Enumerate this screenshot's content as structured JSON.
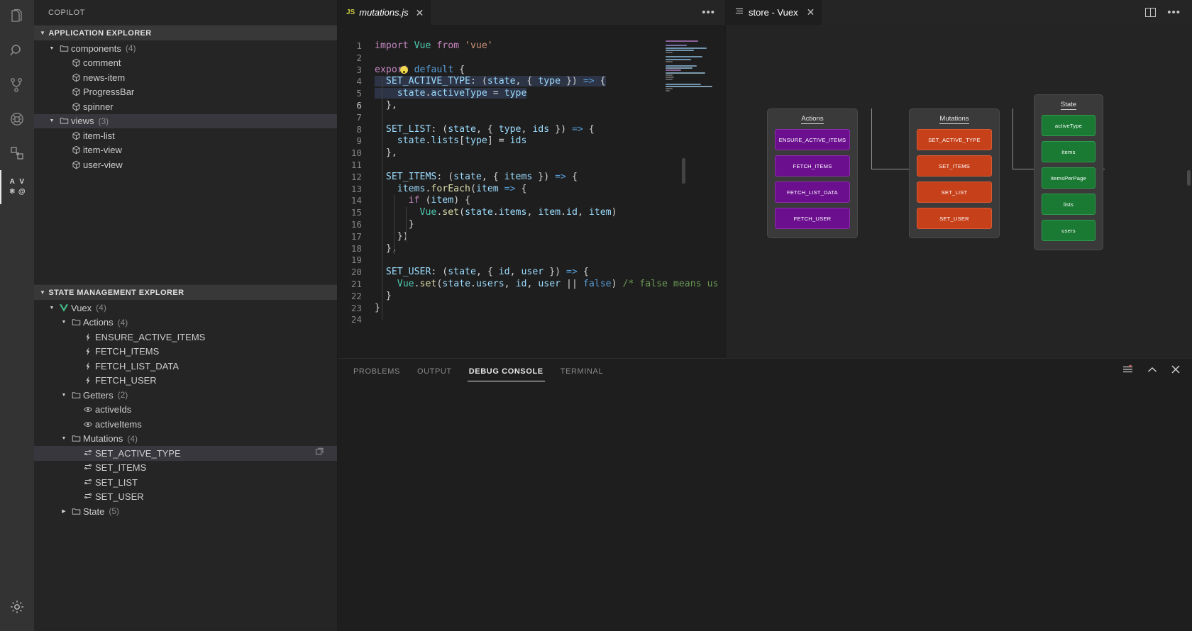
{
  "activity_bar": {
    "items": [
      {
        "name": "explorer-icon",
        "title": "Explorer",
        "active": false
      },
      {
        "name": "search-icon",
        "title": "Search",
        "active": false
      },
      {
        "name": "source-control-icon",
        "title": "Source Control",
        "active": false
      },
      {
        "name": "run-and-debug-icon",
        "title": "Run and Debug",
        "active": false
      },
      {
        "name": "extensions-icon",
        "title": "Extensions",
        "active": false
      },
      {
        "name": "state-explorer-icon",
        "title": "State Explorer",
        "active": true
      }
    ],
    "framework_glyphs": [
      "A",
      "V",
      "⚛",
      "@"
    ],
    "settings": {
      "name": "gear-icon",
      "title": "Manage"
    }
  },
  "sidebar": {
    "title": "COPILOT",
    "sections": [
      {
        "header": "APPLICATION EXPLORER",
        "items": [
          {
            "label": "components",
            "count": "(4)",
            "depth": 1,
            "icon": "folder-icon",
            "twisty": "open",
            "selected": false
          },
          {
            "label": "comment",
            "count": "",
            "depth": 2,
            "icon": "component-icon",
            "twisty": "none",
            "selected": false
          },
          {
            "label": "news-item",
            "count": "",
            "depth": 2,
            "icon": "component-icon",
            "twisty": "none",
            "selected": false
          },
          {
            "label": "ProgressBar",
            "count": "",
            "depth": 2,
            "icon": "component-icon",
            "twisty": "none",
            "selected": false
          },
          {
            "label": "spinner",
            "count": "",
            "depth": 2,
            "icon": "component-icon",
            "twisty": "none",
            "selected": false
          },
          {
            "label": "views",
            "count": "(3)",
            "depth": 1,
            "icon": "folder-icon",
            "twisty": "open",
            "selected": true
          },
          {
            "label": "item-list",
            "count": "",
            "depth": 2,
            "icon": "component-icon",
            "twisty": "none",
            "selected": false
          },
          {
            "label": "item-view",
            "count": "",
            "depth": 2,
            "icon": "component-icon",
            "twisty": "none",
            "selected": false
          },
          {
            "label": "user-view",
            "count": "",
            "depth": 2,
            "icon": "component-icon",
            "twisty": "none",
            "selected": false
          }
        ]
      },
      {
        "header": "STATE MANAGEMENT EXPLORER",
        "items": [
          {
            "label": "Vuex",
            "count": "(4)",
            "depth": 1,
            "icon": "vue-icon",
            "twisty": "open",
            "selected": false
          },
          {
            "label": "Actions",
            "count": "(4)",
            "depth": 2,
            "icon": "folder-icon",
            "twisty": "open",
            "selected": false
          },
          {
            "label": "ENSURE_ACTIVE_ITEMS",
            "count": "",
            "depth": 3,
            "icon": "action-icon",
            "twisty": "none",
            "selected": false
          },
          {
            "label": "FETCH_ITEMS",
            "count": "",
            "depth": 3,
            "icon": "action-icon",
            "twisty": "none",
            "selected": false
          },
          {
            "label": "FETCH_LIST_DATA",
            "count": "",
            "depth": 3,
            "icon": "action-icon",
            "twisty": "none",
            "selected": false
          },
          {
            "label": "FETCH_USER",
            "count": "",
            "depth": 3,
            "icon": "action-icon",
            "twisty": "none",
            "selected": false
          },
          {
            "label": "Getters",
            "count": "(2)",
            "depth": 2,
            "icon": "folder-icon",
            "twisty": "open",
            "selected": false
          },
          {
            "label": "activeIds",
            "count": "",
            "depth": 3,
            "icon": "getter-eye-icon",
            "twisty": "none",
            "selected": false
          },
          {
            "label": "activeItems",
            "count": "",
            "depth": 3,
            "icon": "getter-eye-icon",
            "twisty": "none",
            "selected": false
          },
          {
            "label": "Mutations",
            "count": "(4)",
            "depth": 2,
            "icon": "folder-icon",
            "twisty": "open",
            "selected": false
          },
          {
            "label": "SET_ACTIVE_TYPE",
            "count": "",
            "depth": 3,
            "icon": "mutation-icon",
            "twisty": "none",
            "selected": true,
            "action": "open-preview-icon"
          },
          {
            "label": "SET_ITEMS",
            "count": "",
            "depth": 3,
            "icon": "mutation-icon",
            "twisty": "none",
            "selected": false
          },
          {
            "label": "SET_LIST",
            "count": "",
            "depth": 3,
            "icon": "mutation-icon",
            "twisty": "none",
            "selected": false
          },
          {
            "label": "SET_USER",
            "count": "",
            "depth": 3,
            "icon": "mutation-icon",
            "twisty": "none",
            "selected": false
          },
          {
            "label": "State",
            "count": "(5)",
            "depth": 2,
            "icon": "folder-icon",
            "twisty": "closed",
            "selected": false
          }
        ]
      }
    ]
  },
  "editor": {
    "tab": {
      "badge": "JS",
      "filename": "mutations.js",
      "close": "✕"
    },
    "more_actions": "•••",
    "lines": [
      {
        "n": "1",
        "tokens": [
          {
            "t": "import ",
            "c": "kw"
          },
          {
            "t": "Vue",
            "c": "cls"
          },
          {
            "t": " from ",
            "c": "kw"
          },
          {
            "t": "'vue'",
            "c": "str"
          }
        ]
      },
      {
        "n": "2",
        "tokens": []
      },
      {
        "n": "3",
        "tokens": [
          {
            "t": "export ",
            "c": "kw"
          },
          {
            "t": "default",
            "c": "kw2"
          },
          {
            "t": " {",
            "c": "pl"
          }
        ]
      },
      {
        "n": "4",
        "tokens": [
          {
            "t": "  SET_ACTIVE_TYPE",
            "c": "var"
          },
          {
            "t": ": (",
            "c": "pl"
          },
          {
            "t": "state",
            "c": "var"
          },
          {
            "t": ", { ",
            "c": "pl"
          },
          {
            "t": "type",
            "c": "var"
          },
          {
            "t": " }) ",
            "c": "pl"
          },
          {
            "t": "=>",
            "c": "arrow"
          },
          {
            "t": " {",
            "c": "pl"
          }
        ]
      },
      {
        "n": "5",
        "tokens": [
          {
            "t": "    state",
            "c": "var"
          },
          {
            "t": ".",
            "c": "pl"
          },
          {
            "t": "activeType",
            "c": "var"
          },
          {
            "t": " = ",
            "c": "pl"
          },
          {
            "t": "type",
            "c": "var"
          }
        ]
      },
      {
        "n": "6",
        "tokens": [
          {
            "t": "  },",
            "c": "pl"
          }
        ]
      },
      {
        "n": "7",
        "tokens": []
      },
      {
        "n": "8",
        "tokens": [
          {
            "t": "  SET_LIST",
            "c": "var"
          },
          {
            "t": ": (",
            "c": "pl"
          },
          {
            "t": "state",
            "c": "var"
          },
          {
            "t": ", { ",
            "c": "pl"
          },
          {
            "t": "type",
            "c": "var"
          },
          {
            "t": ", ",
            "c": "pl"
          },
          {
            "t": "ids",
            "c": "var"
          },
          {
            "t": " }) ",
            "c": "pl"
          },
          {
            "t": "=>",
            "c": "arrow"
          },
          {
            "t": " {",
            "c": "pl"
          }
        ]
      },
      {
        "n": "9",
        "tokens": [
          {
            "t": "    state",
            "c": "var"
          },
          {
            "t": ".",
            "c": "pl"
          },
          {
            "t": "lists",
            "c": "var"
          },
          {
            "t": "[",
            "c": "pl"
          },
          {
            "t": "type",
            "c": "var"
          },
          {
            "t": "] = ",
            "c": "pl"
          },
          {
            "t": "ids",
            "c": "var"
          }
        ]
      },
      {
        "n": "10",
        "tokens": [
          {
            "t": "  },",
            "c": "pl"
          }
        ]
      },
      {
        "n": "11",
        "tokens": []
      },
      {
        "n": "12",
        "tokens": [
          {
            "t": "  SET_ITEMS",
            "c": "var"
          },
          {
            "t": ": (",
            "c": "pl"
          },
          {
            "t": "state",
            "c": "var"
          },
          {
            "t": ", { ",
            "c": "pl"
          },
          {
            "t": "items",
            "c": "var"
          },
          {
            "t": " }) ",
            "c": "pl"
          },
          {
            "t": "=>",
            "c": "arrow"
          },
          {
            "t": " {",
            "c": "pl"
          }
        ]
      },
      {
        "n": "13",
        "tokens": [
          {
            "t": "    items",
            "c": "var"
          },
          {
            "t": ".",
            "c": "pl"
          },
          {
            "t": "forEach",
            "c": "fn"
          },
          {
            "t": "(",
            "c": "pl"
          },
          {
            "t": "item",
            "c": "var"
          },
          {
            "t": " ",
            "c": "pl"
          },
          {
            "t": "=>",
            "c": "arrow"
          },
          {
            "t": " {",
            "c": "pl"
          }
        ]
      },
      {
        "n": "14",
        "tokens": [
          {
            "t": "      if",
            "c": "kw"
          },
          {
            "t": " (",
            "c": "pl"
          },
          {
            "t": "item",
            "c": "var"
          },
          {
            "t": ") {",
            "c": "pl"
          }
        ]
      },
      {
        "n": "15",
        "tokens": [
          {
            "t": "        Vue",
            "c": "cls"
          },
          {
            "t": ".",
            "c": "pl"
          },
          {
            "t": "set",
            "c": "fn"
          },
          {
            "t": "(",
            "c": "pl"
          },
          {
            "t": "state",
            "c": "var"
          },
          {
            "t": ".",
            "c": "pl"
          },
          {
            "t": "items",
            "c": "var"
          },
          {
            "t": ", ",
            "c": "pl"
          },
          {
            "t": "item",
            "c": "var"
          },
          {
            "t": ".",
            "c": "pl"
          },
          {
            "t": "id",
            "c": "var"
          },
          {
            "t": ", ",
            "c": "pl"
          },
          {
            "t": "item",
            "c": "var"
          },
          {
            "t": ")",
            "c": "pl"
          }
        ]
      },
      {
        "n": "16",
        "tokens": [
          {
            "t": "      }",
            "c": "pl"
          }
        ]
      },
      {
        "n": "17",
        "tokens": [
          {
            "t": "    })",
            "c": "pl"
          }
        ]
      },
      {
        "n": "18",
        "tokens": [
          {
            "t": "  },",
            "c": "pl"
          }
        ]
      },
      {
        "n": "19",
        "tokens": []
      },
      {
        "n": "20",
        "tokens": [
          {
            "t": "  SET_USER",
            "c": "var"
          },
          {
            "t": ": (",
            "c": "pl"
          },
          {
            "t": "state",
            "c": "var"
          },
          {
            "t": ", { ",
            "c": "pl"
          },
          {
            "t": "id",
            "c": "var"
          },
          {
            "t": ", ",
            "c": "pl"
          },
          {
            "t": "user",
            "c": "var"
          },
          {
            "t": " }) ",
            "c": "pl"
          },
          {
            "t": "=>",
            "c": "arrow"
          },
          {
            "t": " {",
            "c": "pl"
          }
        ]
      },
      {
        "n": "21",
        "tokens": [
          {
            "t": "    Vue",
            "c": "cls"
          },
          {
            "t": ".",
            "c": "pl"
          },
          {
            "t": "set",
            "c": "fn"
          },
          {
            "t": "(",
            "c": "pl"
          },
          {
            "t": "state",
            "c": "var"
          },
          {
            "t": ".",
            "c": "pl"
          },
          {
            "t": "users",
            "c": "var"
          },
          {
            "t": ", ",
            "c": "pl"
          },
          {
            "t": "id",
            "c": "var"
          },
          {
            "t": ", ",
            "c": "pl"
          },
          {
            "t": "user",
            "c": "var"
          },
          {
            "t": " || ",
            "c": "pl"
          },
          {
            "t": "false",
            "c": "kw2"
          },
          {
            "t": ")",
            "c": "pl"
          },
          {
            "t": " /* false means us",
            "c": "com"
          }
        ]
      },
      {
        "n": "22",
        "tokens": [
          {
            "t": "  }",
            "c": "pl"
          }
        ]
      },
      {
        "n": "23",
        "tokens": [
          {
            "t": "}",
            "c": "pl"
          }
        ]
      },
      {
        "n": "24",
        "tokens": []
      }
    ]
  },
  "webview": {
    "tab": {
      "icon": "preview-lines-icon",
      "title": "store - Vuex",
      "close": "✕"
    },
    "actions": [
      {
        "name": "split-editor-icon"
      },
      {
        "name": "more-actions-icon",
        "glyph": "•••"
      }
    ],
    "graph": {
      "columns": [
        {
          "title": "Actions",
          "kind": "action",
          "nodes": [
            "ENSURE_ACTIVE_ITEMS",
            "FETCH_ITEMS",
            "FETCH_LIST_DATA",
            "FETCH_USER"
          ]
        },
        {
          "title": "Mutations",
          "kind": "mutation",
          "nodes": [
            "SET_ACTIVE_TYPE",
            "SET_ITEMS",
            "SET_LIST",
            "SET_USER"
          ]
        },
        {
          "title": "State",
          "kind": "state",
          "nodes": [
            "activeType",
            "items",
            "itemsPerPage",
            "lists",
            "users"
          ]
        }
      ]
    },
    "colors": {
      "action": "#6b0f8f",
      "mutation": "#c6401a",
      "state": "#1a7a34",
      "background": "#242424",
      "group": "#3a3a3a"
    }
  },
  "panel": {
    "tabs": [
      {
        "label": "PROBLEMS",
        "active": false
      },
      {
        "label": "OUTPUT",
        "active": false
      },
      {
        "label": "DEBUG CONSOLE",
        "active": true
      },
      {
        "label": "TERMINAL",
        "active": false
      }
    ],
    "actions": [
      {
        "name": "clear-console-icon"
      },
      {
        "name": "maximize-panel-icon",
        "glyph": "⌃"
      },
      {
        "name": "close-panel-icon",
        "glyph": "✕"
      }
    ],
    "content": ""
  }
}
